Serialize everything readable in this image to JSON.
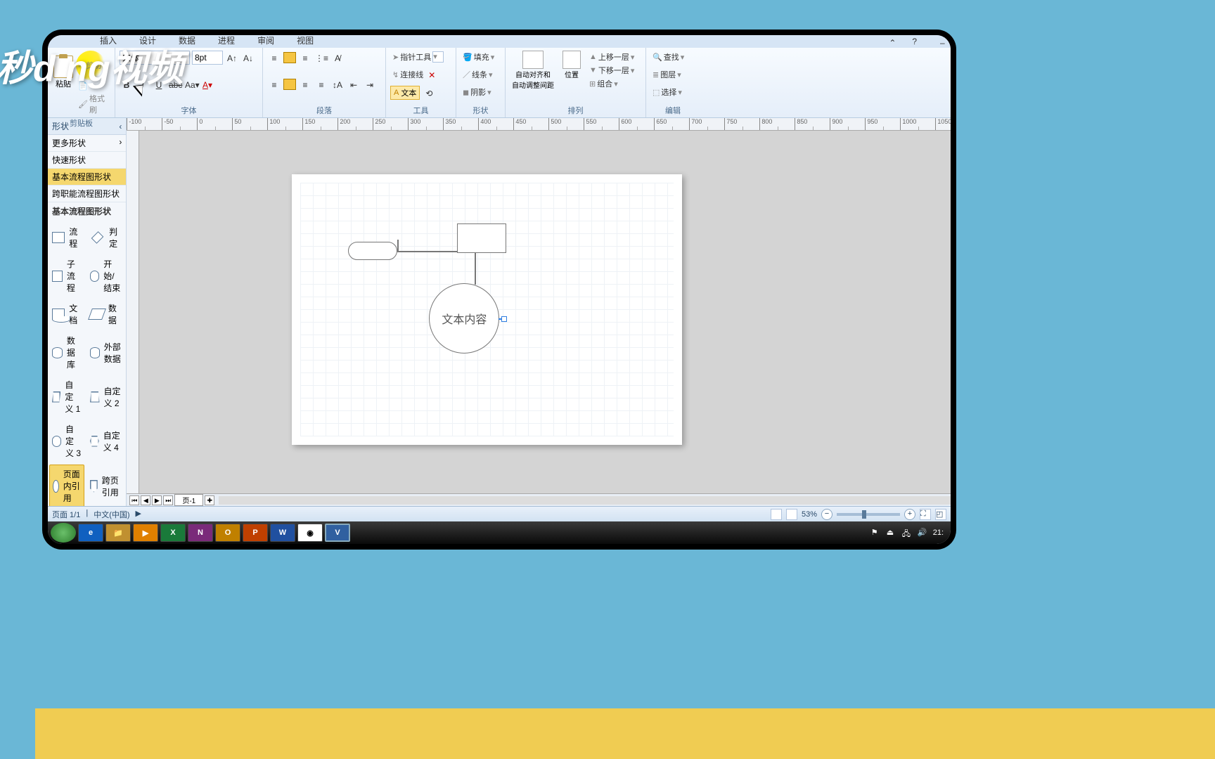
{
  "watermark": "秒d  ng视频",
  "menu": {
    "insert": "插入",
    "design": "设计",
    "data": "数据",
    "process": "进程",
    "review": "审阅",
    "view": "视图"
  },
  "ribbon": {
    "clipboard": {
      "paste": "粘贴",
      "cut": "剪切",
      "copy": "复制",
      "format_painter": "格式刷",
      "label": "剪贴板"
    },
    "font": {
      "family": "宋体",
      "size": "8pt",
      "label": "字体"
    },
    "paragraph": {
      "label": "段落"
    },
    "tools": {
      "pointer": "指针工具",
      "connector": "连接线",
      "text": "文本",
      "label": "工具"
    },
    "shape": {
      "fill": "填充",
      "line": "线条",
      "shadow": "阴影",
      "label": "形状"
    },
    "arrange": {
      "autoalign": "自动对齐和\n自动调整间距",
      "position": "位置",
      "bring_forward": "上移一层",
      "send_backward": "下移一层",
      "group": "组合",
      "label": "排列"
    },
    "editing": {
      "find": "查找",
      "layer": "图层",
      "select": "选择",
      "label": "编辑"
    }
  },
  "sidepane": {
    "shapes_header": "形状",
    "more_shapes": "更多形状",
    "quick_shapes": "快速形状",
    "basic_flowchart": "基本流程图形状",
    "cross_functional": "跨职能流程图形状",
    "sub_header": "基本流程图形状",
    "items": [
      {
        "label": "流程"
      },
      {
        "label": "判定"
      },
      {
        "label": "子流程"
      },
      {
        "label": "开始/结束"
      },
      {
        "label": "文档"
      },
      {
        "label": "数据"
      },
      {
        "label": "数据库"
      },
      {
        "label": "外部数据"
      },
      {
        "label": "自定义 1"
      },
      {
        "label": "自定义 2"
      },
      {
        "label": "自定义 3"
      },
      {
        "label": "自定义 4"
      },
      {
        "label": "页面内引用"
      },
      {
        "label": "跨页引用"
      }
    ]
  },
  "canvas": {
    "circle_text": "文本内容"
  },
  "pagetab": {
    "page1": "页-1"
  },
  "status": {
    "page": "页面 1/1",
    "lang": "中文(中国)",
    "zoom": "53%"
  },
  "taskbar": {
    "time": "21:"
  }
}
